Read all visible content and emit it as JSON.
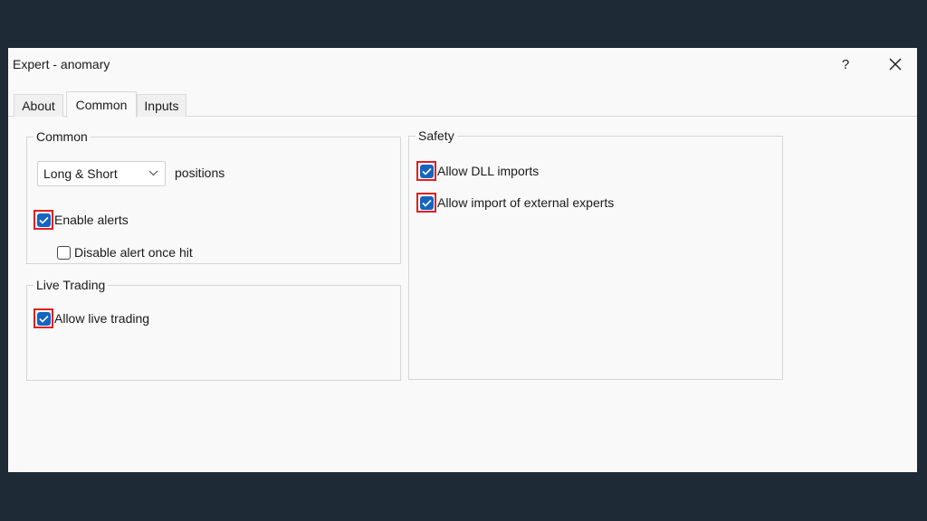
{
  "window": {
    "title": "Expert - anomary",
    "help_glyph": "?"
  },
  "tabs": [
    "About",
    "Common",
    "Inputs"
  ],
  "active_tab": "Common",
  "common_group": {
    "label": "Common",
    "positions_select": {
      "value": "Long & Short"
    },
    "positions_suffix": "positions",
    "enable_alerts": {
      "label": "Enable alerts",
      "checked": true
    },
    "disable_alert_once_hit": {
      "label": "Disable alert once hit",
      "checked": false
    }
  },
  "live_trading_group": {
    "label": "Live Trading",
    "allow_live_trading": {
      "label": "Allow live trading",
      "checked": true
    }
  },
  "safety_group": {
    "label": "Safety",
    "allow_dll_imports": {
      "label": "Allow DLL imports",
      "checked": true
    },
    "allow_import_external_experts": {
      "label": "Allow import of external experts",
      "checked": true
    }
  },
  "colors": {
    "background": "#1e2a36",
    "dialog": "#f9f9f9",
    "checkbox_accent": "#1565c0",
    "highlight": "#e02020"
  }
}
